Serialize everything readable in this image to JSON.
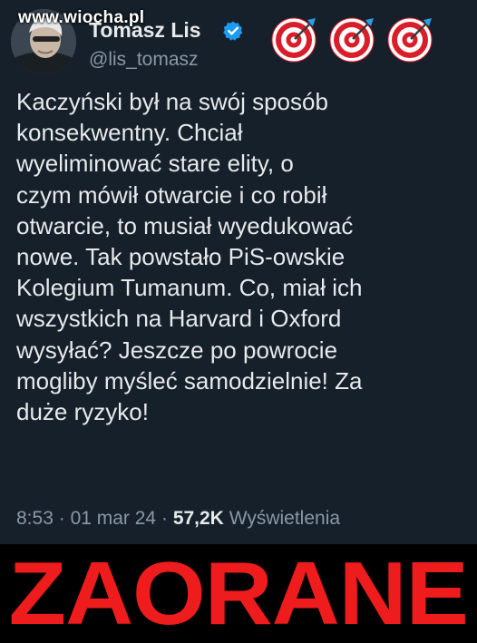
{
  "watermark": "www.wiocha.pl",
  "profile": {
    "display_name": "Tomasz Lis",
    "username": "@lis_tomasz",
    "verified": true,
    "verified_color": "#1d9bf0"
  },
  "header_emojis": [
    "target-icon",
    "target-icon",
    "target-icon"
  ],
  "tweet": {
    "text": "Kaczyński był na swój sposób\nkonsekwentny. Chciał\nwyeliminować stare elity, o\nczym mówił otwarcie i co robił\notwarcie, to musiał wyedukować\nnowe. Tak powstało PiS-owskie\nKolegium Tumanum. Co, miał ich\nwszystkich na Harvard i Oxford\nwysyłać? Jeszcze po powrocie\nmogliby myśleć samodzielnie! Za\nduże ryzyko!",
    "time": "8:53",
    "separator": "·",
    "date": "01 mar 24",
    "views_count": "57,2K",
    "views_label": "Wyświetlenia"
  },
  "banner": {
    "text": "ZAORANE",
    "color": "#ee1c1c"
  },
  "colors": {
    "card_background": "#15202b",
    "primary_text": "#e7e9ea",
    "secondary_text": "#8b98a5"
  }
}
